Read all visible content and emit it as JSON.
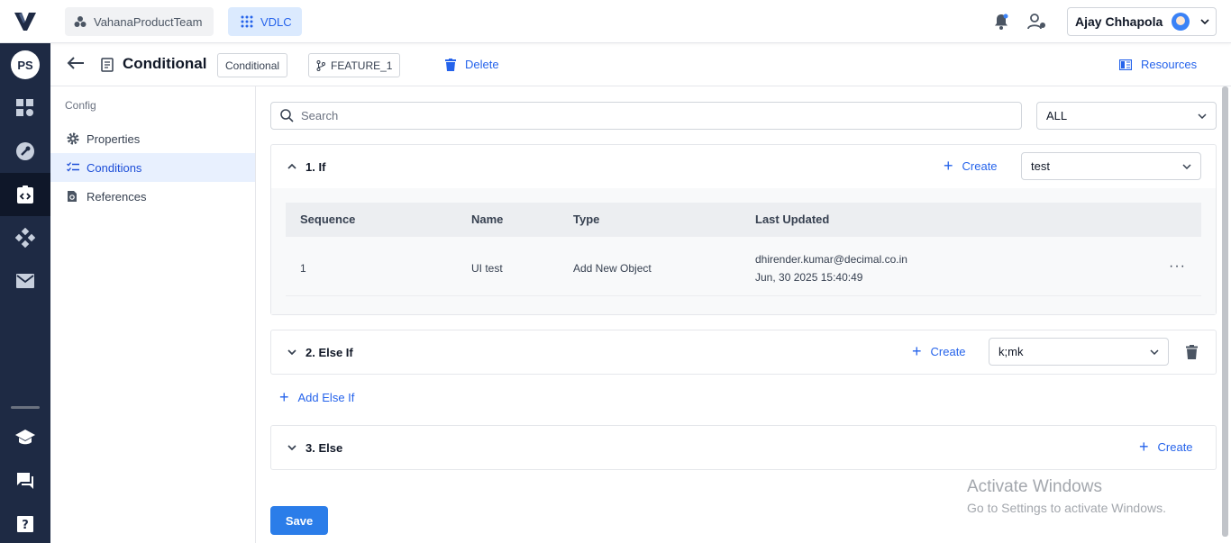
{
  "topbar": {
    "team_label": "VahanaProductTeam",
    "app_label": "VDLC",
    "user_name": "Ajay Chhapola"
  },
  "rail": {
    "avatar_initials": "PS"
  },
  "header": {
    "title": "Conditional",
    "type_chip": "Conditional",
    "branch_chip": "FEATURE_1",
    "delete_label": "Delete",
    "resources_label": "Resources"
  },
  "subnav": {
    "section_title": "Config",
    "items": [
      {
        "label": "Properties"
      },
      {
        "label": "Conditions"
      },
      {
        "label": "References"
      }
    ]
  },
  "main": {
    "search_placeholder": "Search",
    "filter_value": "ALL",
    "create_label": "Create",
    "add_else_if_label": "Add Else If",
    "save_label": "Save",
    "panels": [
      {
        "title": "1. If",
        "select_value": "test"
      },
      {
        "title": "2. Else If",
        "select_value": "k;mk"
      },
      {
        "title": "3. Else"
      }
    ],
    "table": {
      "headers": [
        "Sequence",
        "Name",
        "Type",
        "Last Updated"
      ],
      "rows": [
        {
          "sequence": "1",
          "name": "UI test",
          "type": "Add New Object",
          "updated_by": "dhirender.kumar@decimal.co.in",
          "updated_at": "Jun, 30 2025 15:40:49"
        }
      ]
    }
  },
  "watermark": {
    "line1": "Activate Windows",
    "line2": "Go to Settings to activate Windows."
  },
  "colors": {
    "accent": "#2563eb",
    "rail_bg": "#1e2a44",
    "save_button": "#2b7de9"
  }
}
